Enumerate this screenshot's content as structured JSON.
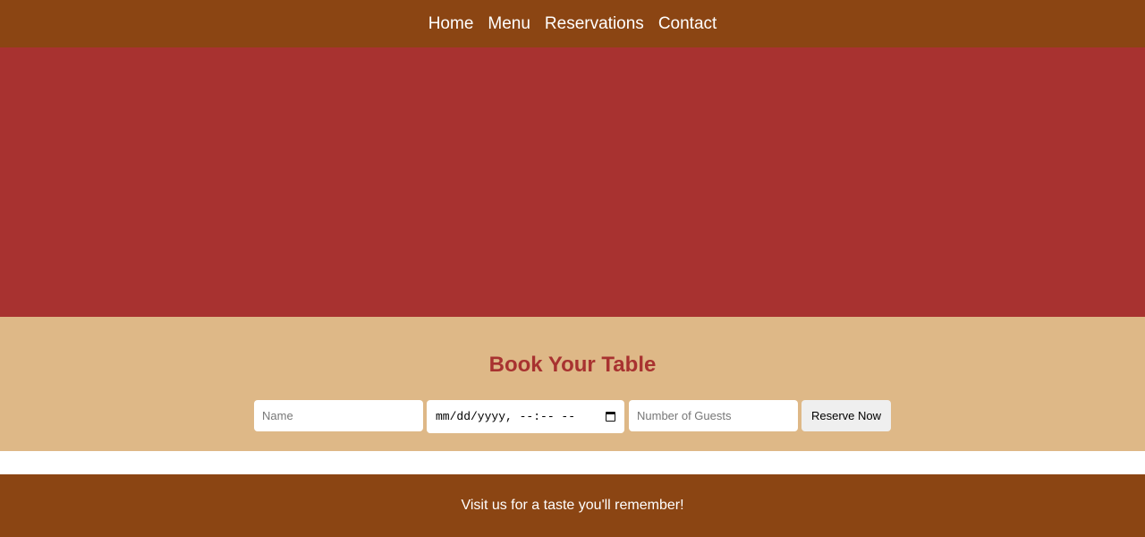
{
  "nav": {
    "items": [
      {
        "label": "Home"
      },
      {
        "label": "Menu"
      },
      {
        "label": "Reservations"
      },
      {
        "label": "Contact"
      }
    ]
  },
  "booking": {
    "title": "Book Your Table",
    "name_placeholder": "Name",
    "datetime_placeholder": "mm/dd/yyyy, --:-- --",
    "datetime_icon": "calendar-icon",
    "guests_placeholder": "Number of Guests",
    "submit_label": "Reserve Now"
  },
  "footer": {
    "text": "Visit us for a taste you'll remember!"
  },
  "colors": {
    "nav_bg": "#8b4513",
    "hero_bg": "#a83230",
    "booking_bg": "#deb887",
    "accent": "#a83230",
    "footer_bg": "#8b4513"
  }
}
